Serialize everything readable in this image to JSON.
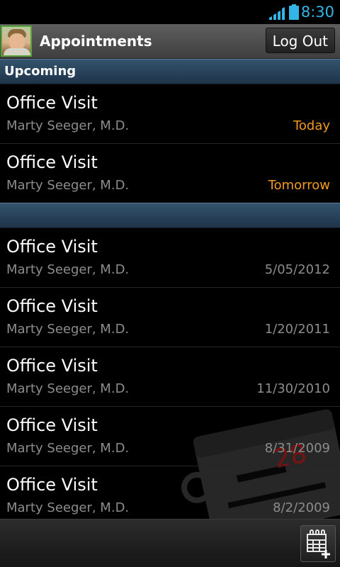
{
  "status_bar": {
    "time": "8:30",
    "icons": [
      "signal-icon",
      "battery-icon"
    ]
  },
  "header": {
    "title": "Appointments",
    "logout_label": "Log Out",
    "avatar": "user-avatar"
  },
  "upcoming": {
    "header": "Upcoming",
    "items": [
      {
        "title": "Office Visit",
        "doctor": "Marty Seeger, M.D.",
        "date": "Today"
      },
      {
        "title": "Office Visit",
        "doctor": "Marty Seeger, M.D.",
        "date": "Tomorrow"
      }
    ]
  },
  "past": {
    "header": "",
    "items": [
      {
        "title": "Office Visit",
        "doctor": "Marty Seeger, M.D.",
        "date": "5/05/2012"
      },
      {
        "title": "Office Visit",
        "doctor": "Marty Seeger, M.D.",
        "date": "1/20/2011"
      },
      {
        "title": "Office Visit",
        "doctor": "Marty Seeger, M.D.",
        "date": "11/30/2010"
      },
      {
        "title": "Office Visit",
        "doctor": "Marty Seeger, M.D.",
        "date": "8/31/2009"
      },
      {
        "title": "Office Visit",
        "doctor": "Marty Seeger, M.D.",
        "date": "8/2/2009"
      }
    ]
  },
  "watermark": {
    "calendar_number": "28"
  },
  "bottom_bar": {
    "add_icon": "calendar-add-icon"
  },
  "colors": {
    "accent_blue": "#33b5e5",
    "highlight_orange": "#f39a1e",
    "section_header": "#2a455c",
    "secondary_text": "#8c8c8c"
  }
}
